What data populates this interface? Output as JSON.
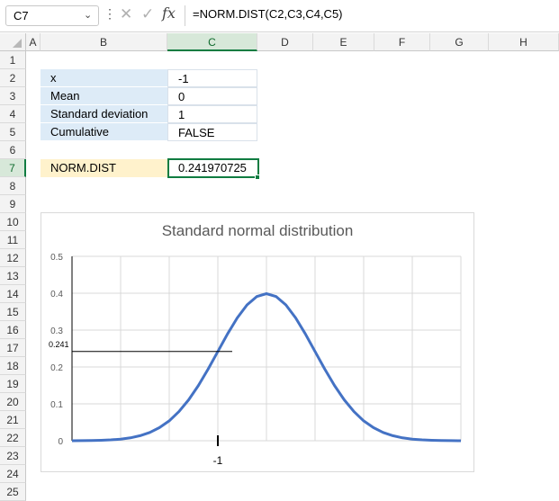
{
  "formula_bar": {
    "name_box": "C7",
    "name_box_dropdown": "⌄",
    "more_icon": "⋮",
    "cancel_icon": "✕",
    "enter_icon": "✓",
    "fx_label": "fx",
    "formula": "=NORM.DIST(C2,C3,C4,C5)"
  },
  "columns": [
    "A",
    "B",
    "C",
    "D",
    "E",
    "F",
    "G",
    "H"
  ],
  "selected_column": "C",
  "rows": [
    "1",
    "2",
    "3",
    "4",
    "5",
    "6",
    "7",
    "8",
    "9",
    "10",
    "11",
    "12",
    "13",
    "14",
    "15",
    "16",
    "17",
    "18",
    "19",
    "20",
    "21",
    "22",
    "23",
    "24",
    "25"
  ],
  "selected_row": "7",
  "inputs": [
    {
      "label": "x",
      "value": "-1"
    },
    {
      "label": "Mean",
      "value": "0"
    },
    {
      "label": "Standard deviation",
      "value": "1"
    },
    {
      "label": "Cumulative",
      "value": "FALSE"
    }
  ],
  "result": {
    "label": "NORM.DIST",
    "value": "0.241970725"
  },
  "colors": {
    "accent": "#107c41",
    "label_fill": "#ddebf7",
    "result_fill": "#fff2cc",
    "series": "#4472c4"
  },
  "chart_data": {
    "type": "line",
    "title": "Standard normal distribution",
    "ylim": [
      0,
      0.5
    ],
    "yticks": [
      0,
      0.1,
      0.2,
      0.3,
      0.4,
      0.5
    ],
    "xlim": [
      -4,
      4
    ],
    "grid": true,
    "series": [
      {
        "x": [
          -4,
          -3.8,
          -3.6,
          -3.4,
          -3.2,
          -3,
          -2.8,
          -2.6,
          -2.4,
          -2.2,
          -2,
          -1.8,
          -1.6,
          -1.4,
          -1.2,
          -1,
          -0.8,
          -0.6,
          -0.4,
          -0.2,
          0,
          0.2,
          0.4,
          0.6,
          0.8,
          1,
          1.2,
          1.4,
          1.6,
          1.8,
          2,
          2.2,
          2.4,
          2.6,
          2.8,
          3,
          3.2,
          3.4,
          3.6,
          3.8,
          4
        ],
        "y": [
          0.0001,
          0.0003,
          0.0006,
          0.0012,
          0.0024,
          0.0044,
          0.0079,
          0.0136,
          0.0224,
          0.0355,
          0.054,
          0.079,
          0.1109,
          0.1497,
          0.1942,
          0.242,
          0.2897,
          0.3332,
          0.3683,
          0.391,
          0.3989,
          0.391,
          0.3683,
          0.3332,
          0.2897,
          0.242,
          0.1942,
          0.1497,
          0.1109,
          0.079,
          0.054,
          0.0355,
          0.0224,
          0.0136,
          0.0079,
          0.0044,
          0.0024,
          0.0012,
          0.0006,
          0.0003,
          0.0001
        ]
      }
    ],
    "marker": {
      "x": -1,
      "y": 0.241970725,
      "x_label": "-1",
      "y_label": "0.241"
    }
  }
}
